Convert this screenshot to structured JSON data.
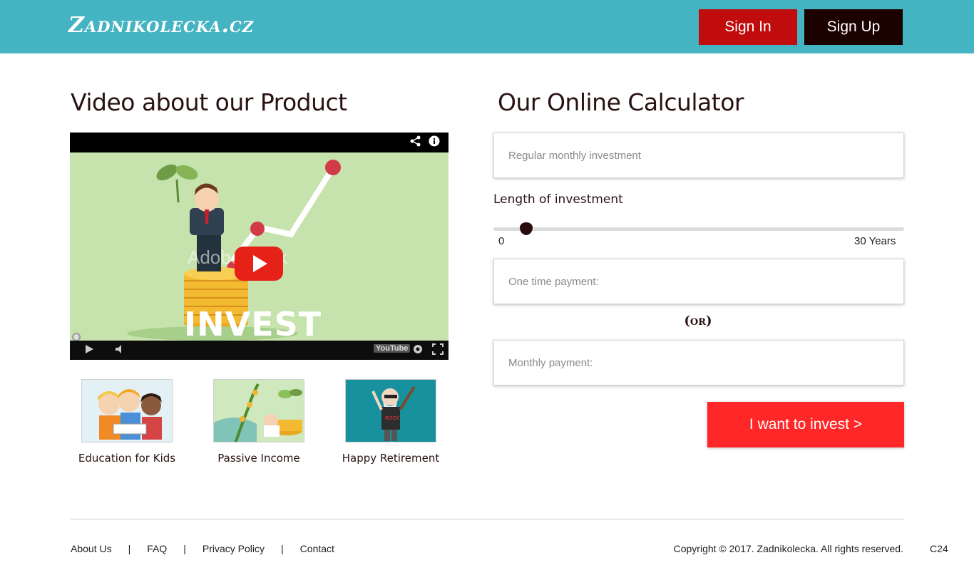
{
  "header": {
    "logo": "Zadnikolecka.cz",
    "sign_in": "Sign In",
    "sign_up": "Sign Up",
    "bg_color": "#44b3c2",
    "sign_in_color": "#c00c0c",
    "sign_up_color": "#1c0101"
  },
  "video_section": {
    "title": "Video about our Product",
    "video": {
      "watermark": "AdobeStock",
      "headline": "INVEST",
      "icons": [
        "share-icon",
        "info-icon",
        "play-icon",
        "volume-icon",
        "youtube-logo",
        "settings-icon",
        "fullscreen-icon"
      ],
      "youtube_label": "YouTube"
    },
    "thumbnails": [
      {
        "label": "Education for Kids",
        "icon": "kids-reading-image"
      },
      {
        "label": "Passive Income",
        "icon": "money-plant-image"
      },
      {
        "label": "Happy Retirement",
        "icon": "rock-grandpa-image"
      }
    ]
  },
  "calculator": {
    "title": "Our Online Calculator",
    "monthly_investment_placeholder": "Regular monthly investment",
    "length_label": "Length of investment",
    "slider_min": "0",
    "slider_max": "30 Years",
    "slider_value_fraction": 0.08,
    "one_time_placeholder": "One time payment:",
    "or_text": "(or)",
    "monthly_payment_placeholder": "Monthly payment:",
    "invest_button": "I want to invest >",
    "invest_color": "#ff2727"
  },
  "footer": {
    "links": [
      "About Us",
      "FAQ",
      "Privacy Policy",
      "Contact"
    ],
    "separator": "|",
    "copyright": "Copyright © 2017. Zadnikolecka. All rights reserved.",
    "badge": "C24"
  }
}
